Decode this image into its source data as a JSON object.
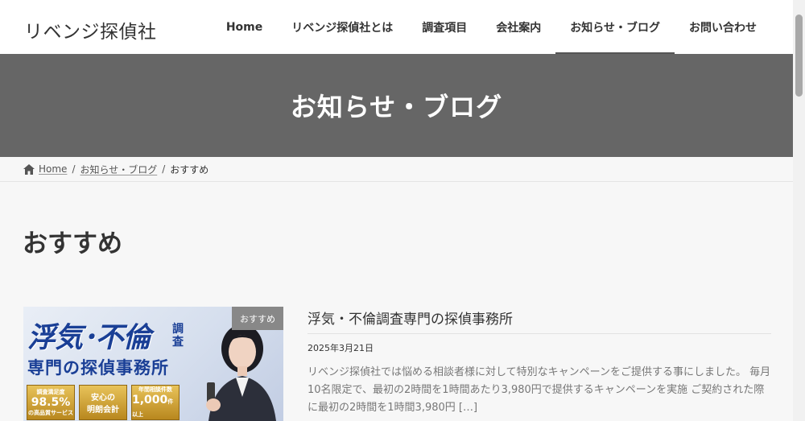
{
  "site": {
    "logo": "リベンジ探偵社"
  },
  "nav": [
    {
      "label": "Home"
    },
    {
      "label": "リベンジ探偵社とは"
    },
    {
      "label": "調査項目"
    },
    {
      "label": "会社案内"
    },
    {
      "label": "お知らせ・ブログ",
      "active": true
    },
    {
      "label": "お問い合わせ"
    }
  ],
  "page": {
    "title": "お知らせ・ブログ"
  },
  "breadcrumb": {
    "home": "Home",
    "parent": "お知らせ・ブログ",
    "current": "おすすめ",
    "separator": "/"
  },
  "archive": {
    "title": "おすすめ"
  },
  "post": {
    "category": "おすすめ",
    "title": "浮気・不倫調査専門の探偵事務所",
    "date": "2025年3月21日",
    "excerpt": "リベンジ探偵社では悩める相談者様に対して特別なキャンペーンをご提供する事にしました。 毎月10名限定で、最初の2時間を1時間あたり3,980円で提供するキャンペーンを実施 ご契約された際に最初の2時間を1時間3,980円 […]",
    "thumbnail": {
      "headline": "浮気･不倫",
      "side": "調査",
      "subhead": "専門の探偵事務所",
      "badge1_top": "調査満足度",
      "badge1_big": "98.5%",
      "badge1_bottom": "の高品質サービス",
      "badge2_top": "安心の",
      "badge2_bottom": "明朗会計",
      "badge3_top": "年間相談件数",
      "badge3_big": "1,000",
      "badge3_unit": "件以上"
    }
  },
  "colors": {
    "band": "#666666",
    "badge": "#888888",
    "brand_blue": "#1a3f96"
  }
}
